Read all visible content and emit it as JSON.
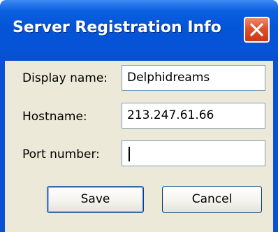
{
  "window": {
    "title": "Server Registration Info",
    "close_icon": "close-x-icon"
  },
  "form": {
    "display_name": {
      "label": "Display name:",
      "value": "Delphidreams"
    },
    "hostname": {
      "label": "Hostname:",
      "value": "213.247.61.66"
    },
    "port_number": {
      "label": "Port number:",
      "value": ""
    }
  },
  "buttons": {
    "save_label": "Save",
    "cancel_label": "Cancel"
  },
  "colors": {
    "titlebar": "#0454d6",
    "client_background": "#ece9d8",
    "close_button": "#e0502b",
    "field_border": "#7f9db9"
  }
}
